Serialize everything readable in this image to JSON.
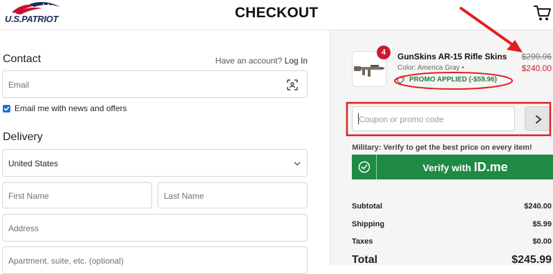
{
  "brand": {
    "name": "U.S.PATRIOT"
  },
  "header": {
    "title": "CHECKOUT"
  },
  "contact": {
    "title": "Contact",
    "account_prompt": "Have an account?",
    "login_link": "Log In",
    "email_placeholder": "Email",
    "newsletter_label": "Email me with news and offers",
    "newsletter_checked": true
  },
  "delivery": {
    "title": "Delivery",
    "country_value": "United States",
    "first_name_placeholder": "First Name",
    "last_name_placeholder": "Last Name",
    "address_placeholder": "Address",
    "apartment_placeholder": "Apartment, suite, etc. (optional)"
  },
  "cart": {
    "quantity": "4",
    "product_name": "GunSkins AR-15 Rifle Skins",
    "variant": "Color: America Gray",
    "price_original": "$299.96",
    "price_sale": "$240.00",
    "promo_text": "PROMO APPLIED (-$59.96)"
  },
  "coupon": {
    "placeholder": "Coupon or promo code"
  },
  "military": {
    "prompt": "Military: Verify to get the best price on every item!",
    "button_prefix": "Verify with",
    "button_brand": "ID.me"
  },
  "summary": {
    "subtotal_label": "Subtotal",
    "subtotal_value": "$240.00",
    "shipping_label": "Shipping",
    "shipping_value": "$5.99",
    "taxes_label": "Taxes",
    "taxes_value": "$0.00",
    "total_label": "Total",
    "total_value": "$245.99"
  },
  "colors": {
    "brand_red": "#cc1c2c",
    "promo_green": "#2b7a3f",
    "verify_green": "#1f8a44",
    "checkbox_blue": "#1a73c9",
    "annotation_red": "#e21d1d"
  }
}
